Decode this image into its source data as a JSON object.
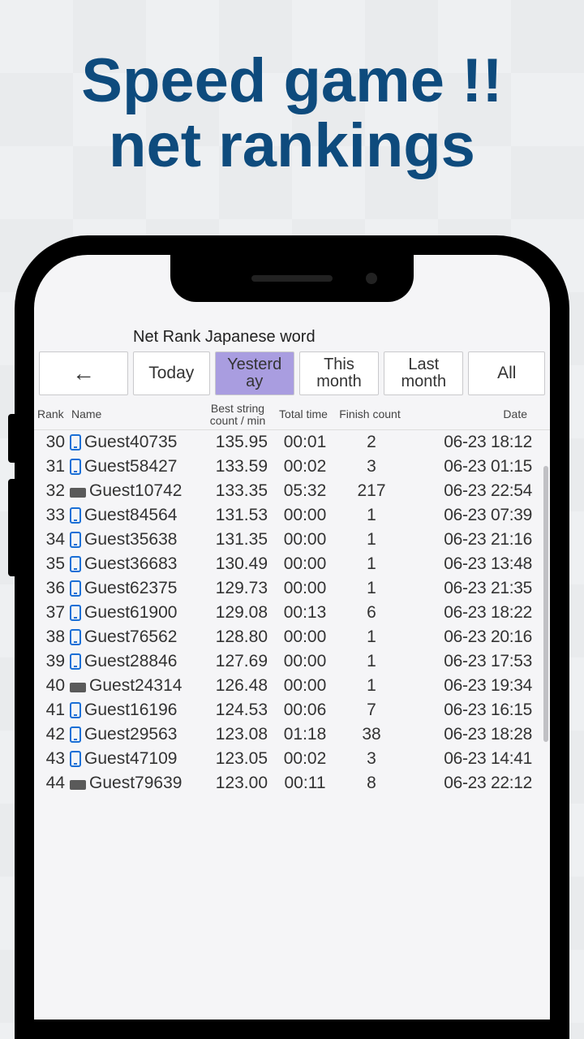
{
  "hero": {
    "line1": "Speed game !!",
    "line2": "net rankings"
  },
  "screen_title": "Net Rank Japanese word",
  "back_label": "←",
  "tabs": [
    {
      "id": "today",
      "label": "Today",
      "selected": false
    },
    {
      "id": "yesterday",
      "label": "Yesterday",
      "selected": true
    },
    {
      "id": "this-month",
      "label": "This month",
      "selected": false
    },
    {
      "id": "last-month",
      "label": "Last month",
      "selected": false
    },
    {
      "id": "all",
      "label": "All",
      "selected": false
    }
  ],
  "columns": {
    "rank": "Rank",
    "name": "Name",
    "score": "Best string count / min",
    "time": "Total time",
    "finish": "Finish count",
    "date": "Date"
  },
  "rows": [
    {
      "rank": 30,
      "device": "phone",
      "name": "Guest40735",
      "score": "135.95",
      "time": "00:01",
      "finish": 2,
      "date": "06-23 18:12"
    },
    {
      "rank": 31,
      "device": "phone",
      "name": "Guest58427",
      "score": "133.59",
      "time": "00:02",
      "finish": 3,
      "date": "06-23 01:15"
    },
    {
      "rank": 32,
      "device": "kb",
      "name": "Guest10742",
      "score": "133.35",
      "time": "05:32",
      "finish": 217,
      "date": "06-23 22:54"
    },
    {
      "rank": 33,
      "device": "phone",
      "name": "Guest84564",
      "score": "131.53",
      "time": "00:00",
      "finish": 1,
      "date": "06-23 07:39"
    },
    {
      "rank": 34,
      "device": "phone",
      "name": "Guest35638",
      "score": "131.35",
      "time": "00:00",
      "finish": 1,
      "date": "06-23 21:16"
    },
    {
      "rank": 35,
      "device": "phone",
      "name": "Guest36683",
      "score": "130.49",
      "time": "00:00",
      "finish": 1,
      "date": "06-23 13:48"
    },
    {
      "rank": 36,
      "device": "phone",
      "name": "Guest62375",
      "score": "129.73",
      "time": "00:00",
      "finish": 1,
      "date": "06-23 21:35"
    },
    {
      "rank": 37,
      "device": "phone",
      "name": "Guest61900",
      "score": "129.08",
      "time": "00:13",
      "finish": 6,
      "date": "06-23 18:22"
    },
    {
      "rank": 38,
      "device": "phone",
      "name": "Guest76562",
      "score": "128.80",
      "time": "00:00",
      "finish": 1,
      "date": "06-23 20:16"
    },
    {
      "rank": 39,
      "device": "phone",
      "name": "Guest28846",
      "score": "127.69",
      "time": "00:00",
      "finish": 1,
      "date": "06-23 17:53"
    },
    {
      "rank": 40,
      "device": "kb",
      "name": "Guest24314",
      "score": "126.48",
      "time": "00:00",
      "finish": 1,
      "date": "06-23 19:34"
    },
    {
      "rank": 41,
      "device": "phone",
      "name": "Guest16196",
      "score": "124.53",
      "time": "00:06",
      "finish": 7,
      "date": "06-23 16:15"
    },
    {
      "rank": 42,
      "device": "phone",
      "name": "Guest29563",
      "score": "123.08",
      "time": "01:18",
      "finish": 38,
      "date": "06-23 18:28"
    },
    {
      "rank": 43,
      "device": "phone",
      "name": "Guest47109",
      "score": "123.05",
      "time": "00:02",
      "finish": 3,
      "date": "06-23 14:41"
    },
    {
      "rank": 44,
      "device": "kb",
      "name": "Guest79639",
      "score": "123.00",
      "time": "00:11",
      "finish": 8,
      "date": "06-23 22:12"
    }
  ]
}
